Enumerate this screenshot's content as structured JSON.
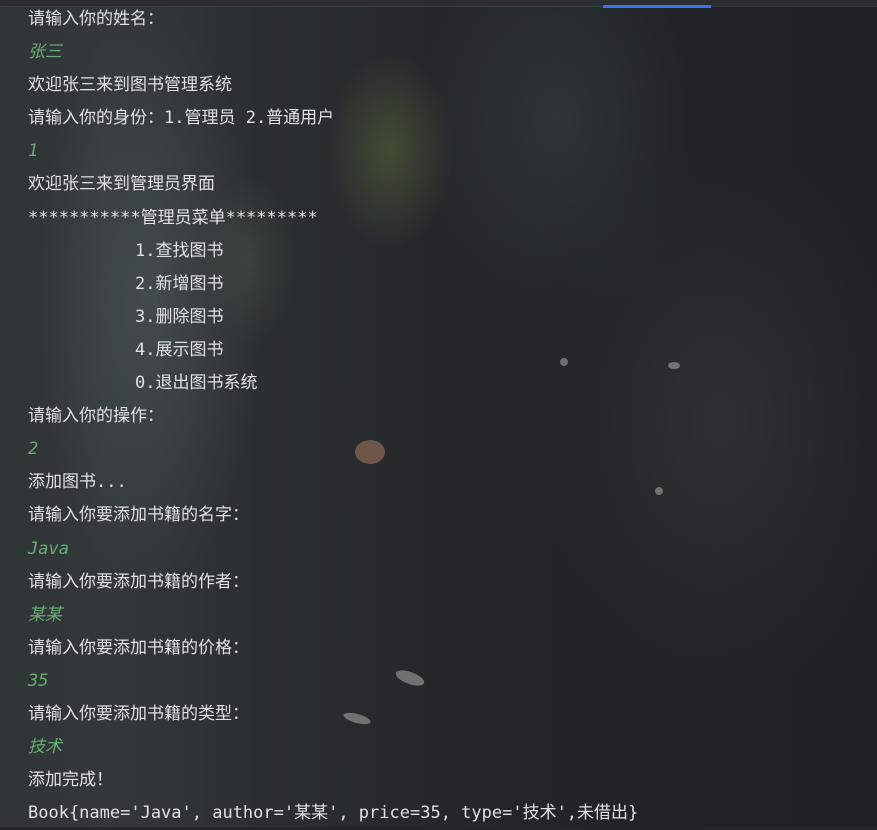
{
  "console": {
    "lines": [
      {
        "text": "请输入你的姓名：",
        "kind": "output"
      },
      {
        "text": "张三",
        "kind": "input"
      },
      {
        "text": "欢迎张三来到图书管理系统",
        "kind": "output"
      },
      {
        "text": "请输入你的身份：1.管理员 2.普通用户",
        "kind": "output"
      },
      {
        "text": "1",
        "kind": "input"
      },
      {
        "text": "欢迎张三来到管理员界面",
        "kind": "output"
      },
      {
        "text": "***********管理员菜单*********",
        "kind": "output"
      },
      {
        "text": "1.查找图书",
        "kind": "menu"
      },
      {
        "text": "2.新增图书",
        "kind": "menu"
      },
      {
        "text": "3.删除图书",
        "kind": "menu"
      },
      {
        "text": "4.展示图书",
        "kind": "menu"
      },
      {
        "text": "0.退出图书系统",
        "kind": "menu"
      },
      {
        "text": "请输入你的操作：",
        "kind": "output"
      },
      {
        "text": "2",
        "kind": "input"
      },
      {
        "text": "添加图书...",
        "kind": "output"
      },
      {
        "text": "请输入你要添加书籍的名字：",
        "kind": "output"
      },
      {
        "text": "Java",
        "kind": "input"
      },
      {
        "text": "请输入你要添加书籍的作者：",
        "kind": "output"
      },
      {
        "text": "某某",
        "kind": "input"
      },
      {
        "text": "请输入你要添加书籍的价格：",
        "kind": "output"
      },
      {
        "text": "35",
        "kind": "input"
      },
      {
        "text": "请输入你要添加书籍的类型：",
        "kind": "output"
      },
      {
        "text": "技术",
        "kind": "input"
      },
      {
        "text": "添加完成！",
        "kind": "output"
      },
      {
        "text": "Book{name='Java', author='某某', price=35, type='技术',未借出}",
        "kind": "output"
      }
    ]
  },
  "colors": {
    "output_text": "#dfe1e5",
    "input_text": "#6aab73",
    "tab_indicator": "#3574f0"
  }
}
